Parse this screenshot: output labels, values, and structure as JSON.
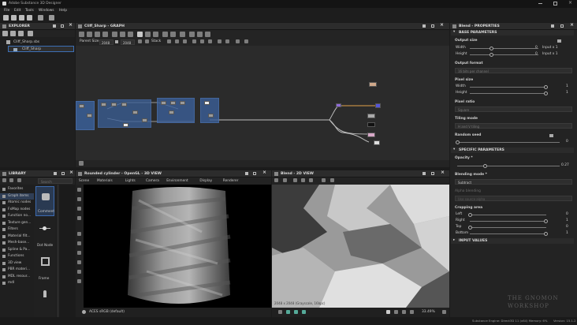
{
  "app": {
    "title": "Adobe Substance 3D Designer",
    "menu": [
      "File",
      "Edit",
      "Tools",
      "Windows",
      "Help"
    ]
  },
  "explorer": {
    "title": "EXPLORER",
    "file": "Cliff_Sharp.sbs",
    "graph": "Cliff_Sharp"
  },
  "graph": {
    "title": "Cliff_Sharp - GRAPH",
    "parent_size_label": "Parent Size:",
    "size_a": "2048",
    "size_b": "2048",
    "stack_label": "Stack"
  },
  "library": {
    "title": "LIBRARY",
    "search_placeholder": "Search",
    "categories": [
      "Favorites",
      "Graph items",
      "Atomic nodes",
      "FxMap nodes",
      "Function no...",
      "Texture gen...",
      "Filters",
      "Material filt...",
      "Mesh-base...",
      "Spline & Pa...",
      "Functions",
      "3D view",
      "PBR materi...",
      "MDL resour...",
      "mdl"
    ],
    "items": [
      "Comment",
      "Dot Node",
      "Frame"
    ]
  },
  "view3d": {
    "title": "Rounded cylinder - OpenGL - 3D VIEW",
    "menu": [
      "Scene",
      "Materials",
      "Lights",
      "Camera",
      "Environment",
      "Display",
      "Renderer"
    ],
    "colorspace": "ACES sRGB (default)"
  },
  "view2d": {
    "title": "Blend - 2D VIEW",
    "info": "2048 x 2048 (Grayscale, 16bpc)",
    "zoom": "33.49%"
  },
  "props": {
    "title": "Blend - PROPERTIES",
    "base_header": "BASE PARAMETERS",
    "output_size": "Output size",
    "width": "Width",
    "height": "Height",
    "w_val": "0",
    "h_val": "0",
    "input_x1": "Input x 1",
    "input_y1": "Input x 1",
    "output_format": "Output format",
    "output_format_val": "16 bits per channel",
    "pixel_size": "Pixel size",
    "px_w_val": "1",
    "px_h_val": "1",
    "pixel_ratio": "Pixel ratio",
    "pixel_ratio_val": "Square",
    "tiling_mode": "Tiling mode",
    "tiling_val": "H and V tiling",
    "random_seed": "Random seed",
    "seed_val": "0",
    "specific_header": "SPECIFIC PARAMETERS",
    "opacity": "Opacity *",
    "opacity_val": "0.27",
    "opacity_level": 0.27,
    "blending_mode": "Blending mode *",
    "blending_val": "Subtract",
    "alpha_blending": "Alpha blending",
    "alpha_val": "Use source alpha",
    "cropping": "Cropping area",
    "left": "Left",
    "right": "Right",
    "top": "Top",
    "bottom": "Bottom",
    "left_val": "0",
    "right_val": "1",
    "top_val": "0",
    "bottom_val": "1",
    "input_values": "INPUT VALUES"
  },
  "status": {
    "engine": "Substance Engine: Direct3D 11 (x64)  Memory: 6%",
    "version": "Version: 15.1.2"
  },
  "watermark": {
    "line1": "THE GNOMON",
    "line2": "WORKSHOP"
  }
}
